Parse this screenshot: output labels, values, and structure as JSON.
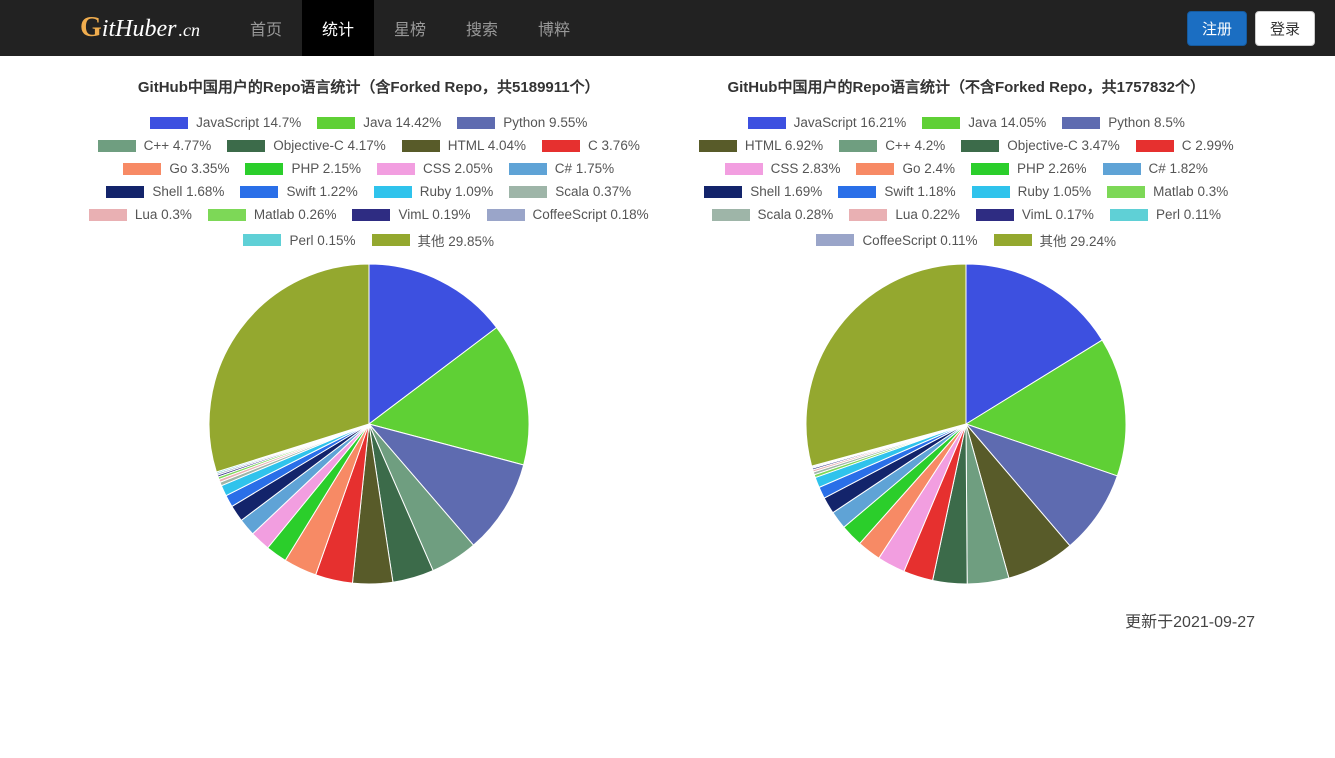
{
  "nav": {
    "brand_g": "G",
    "brand_rest": "itHuber",
    "brand_cn": ".cn",
    "items": [
      "首页",
      "统计",
      "星榜",
      "搜索",
      "博粹"
    ],
    "active_index": 1,
    "register": "注册",
    "login": "登录"
  },
  "footer_note": "更新于2021-09-27",
  "chart_data": [
    {
      "type": "pie",
      "title": "GitHub中国用户的Repo语言统计（含Forked Repo，共5189911个）",
      "series": [
        {
          "name": "JavaScript",
          "value": 14.7,
          "color": "#3d50e0"
        },
        {
          "name": "Java",
          "value": 14.42,
          "color": "#5fd035"
        },
        {
          "name": "Python",
          "value": 9.55,
          "color": "#5e6bb0"
        },
        {
          "name": "C++",
          "value": 4.77,
          "color": "#6f9e80"
        },
        {
          "name": "Objective-C",
          "value": 4.17,
          "color": "#3c6b4a"
        },
        {
          "name": "HTML",
          "value": 4.04,
          "color": "#585b29"
        },
        {
          "name": "C",
          "value": 3.76,
          "color": "#e6302f"
        },
        {
          "name": "Go",
          "value": 3.35,
          "color": "#f78a65"
        },
        {
          "name": "PHP",
          "value": 2.15,
          "color": "#2bce2b"
        },
        {
          "name": "CSS",
          "value": 2.05,
          "color": "#f29ee0"
        },
        {
          "name": "C#",
          "value": 1.75,
          "color": "#5fa3d6"
        },
        {
          "name": "Shell",
          "value": 1.68,
          "color": "#13246b"
        },
        {
          "name": "Swift",
          "value": 1.22,
          "color": "#2a6fe8"
        },
        {
          "name": "Ruby",
          "value": 1.09,
          "color": "#2fc3ec"
        },
        {
          "name": "Scala",
          "value": 0.37,
          "color": "#9eb5a8"
        },
        {
          "name": "Lua",
          "value": 0.3,
          "color": "#e9b0b3"
        },
        {
          "name": "Matlab",
          "value": 0.26,
          "color": "#7dd857"
        },
        {
          "name": "VimL",
          "value": 0.19,
          "color": "#2e2c82"
        },
        {
          "name": "CoffeeScript",
          "value": 0.18,
          "color": "#9aa5c9"
        },
        {
          "name": "Perl",
          "value": 0.15,
          "color": "#5fd0d6"
        },
        {
          "name": "其他",
          "value": 29.85,
          "color": "#94a82f"
        }
      ]
    },
    {
      "type": "pie",
      "title": "GitHub中国用户的Repo语言统计（不含Forked Repo，共1757832个）",
      "series": [
        {
          "name": "JavaScript",
          "value": 16.21,
          "color": "#3d50e0"
        },
        {
          "name": "Java",
          "value": 14.05,
          "color": "#5fd035"
        },
        {
          "name": "Python",
          "value": 8.5,
          "color": "#5e6bb0"
        },
        {
          "name": "HTML",
          "value": 6.92,
          "color": "#585b29"
        },
        {
          "name": "C++",
          "value": 4.2,
          "color": "#6f9e80"
        },
        {
          "name": "Objective-C",
          "value": 3.47,
          "color": "#3c6b4a"
        },
        {
          "name": "C",
          "value": 2.99,
          "color": "#e6302f"
        },
        {
          "name": "CSS",
          "value": 2.83,
          "color": "#f29ee0"
        },
        {
          "name": "Go",
          "value": 2.4,
          "color": "#f78a65"
        },
        {
          "name": "PHP",
          "value": 2.26,
          "color": "#2bce2b"
        },
        {
          "name": "C#",
          "value": 1.82,
          "color": "#5fa3d6"
        },
        {
          "name": "Shell",
          "value": 1.69,
          "color": "#13246b"
        },
        {
          "name": "Swift",
          "value": 1.18,
          "color": "#2a6fe8"
        },
        {
          "name": "Ruby",
          "value": 1.05,
          "color": "#2fc3ec"
        },
        {
          "name": "Matlab",
          "value": 0.3,
          "color": "#7dd857"
        },
        {
          "name": "Scala",
          "value": 0.28,
          "color": "#9eb5a8"
        },
        {
          "name": "Lua",
          "value": 0.22,
          "color": "#e9b0b3"
        },
        {
          "name": "VimL",
          "value": 0.17,
          "color": "#2e2c82"
        },
        {
          "name": "Perl",
          "value": 0.11,
          "color": "#5fd0d6"
        },
        {
          "name": "CoffeeScript",
          "value": 0.11,
          "color": "#9aa5c9"
        },
        {
          "name": "其他",
          "value": 29.24,
          "color": "#94a82f"
        }
      ]
    }
  ]
}
